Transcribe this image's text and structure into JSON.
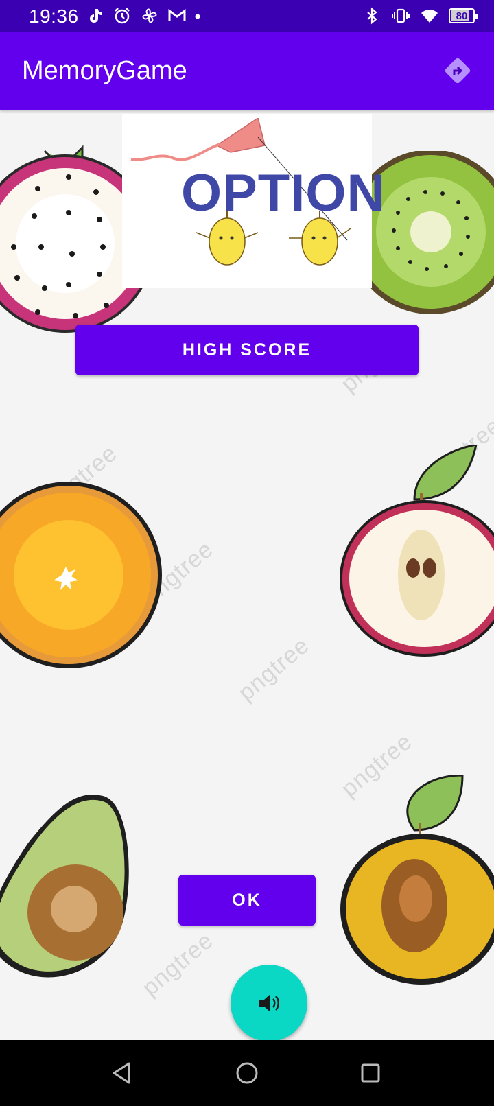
{
  "status_bar": {
    "time": "19:36",
    "left_icons": [
      "tiktok-icon",
      "alarm-icon",
      "pinwheel-icon",
      "gmail-icon",
      "dot-icon"
    ],
    "right_icons": [
      "bluetooth-icon",
      "vibrate-icon",
      "wifi-icon"
    ],
    "battery_level": "80"
  },
  "app_bar": {
    "title": "MemoryGame",
    "action_icon": "directions-icon"
  },
  "main": {
    "banner_text": "OPTION",
    "high_score_label": "HIGH SCORE",
    "ok_label": "OK",
    "fab_icon": "volume-icon",
    "watermark_text": "pngtree"
  },
  "nav_bar": {
    "back_icon": "back-icon",
    "home_icon": "home-icon",
    "recents_icon": "recents-icon"
  },
  "colors": {
    "status_bar": "#3c00b3",
    "app_bar": "#6200ee",
    "button": "#6200ee",
    "fab": "#0bd8c4",
    "banner_text": "#3f48a6",
    "background": "#f4f4f4"
  }
}
